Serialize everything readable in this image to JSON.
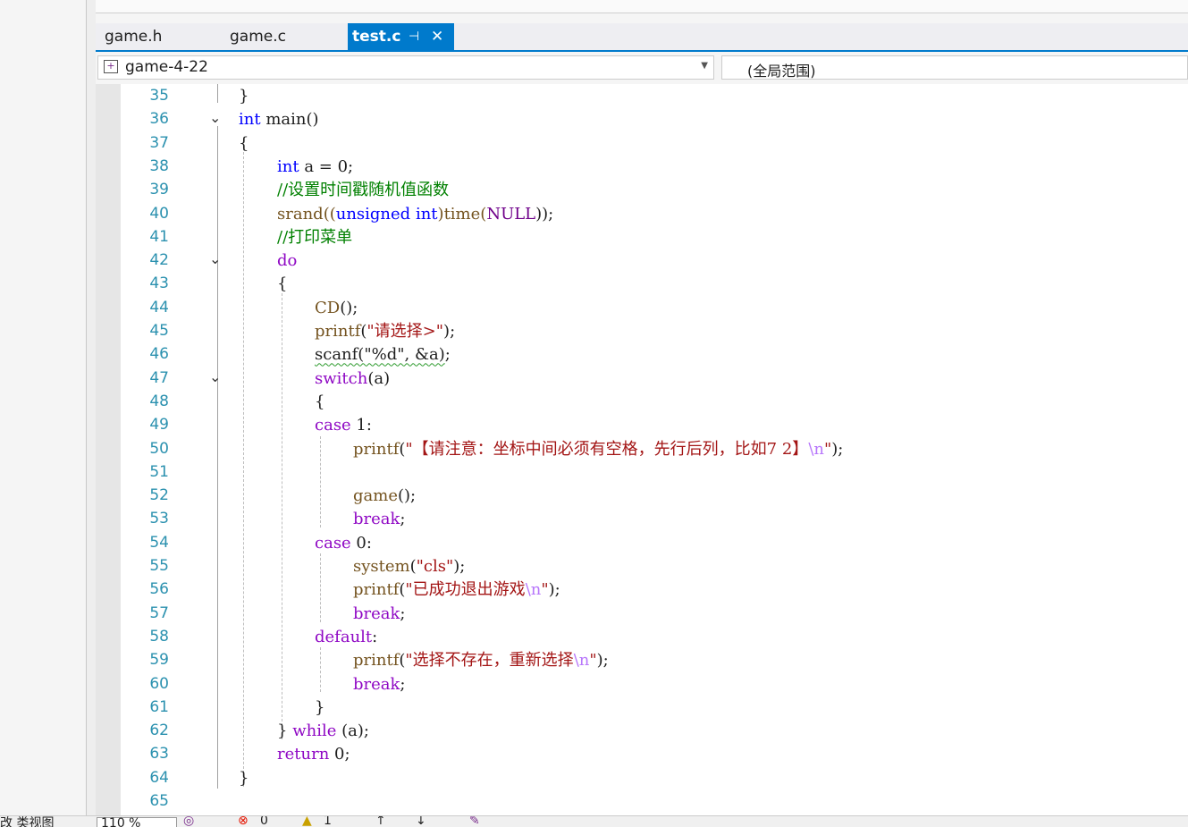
{
  "tabs": [
    {
      "label": "game.h",
      "active": false
    },
    {
      "label": "game.c",
      "active": false
    },
    {
      "label": "test.c",
      "active": true
    }
  ],
  "tab_pin_glyph": "⊣",
  "tab_close_glyph": "✕",
  "nav": {
    "project": "game-4-22",
    "scope": "(全局范围)"
  },
  "status": {
    "left_text": "改   类视图",
    "zoom": "110 %",
    "errors": "0",
    "warnings": "1"
  },
  "colors": {
    "accent": "#007acc",
    "line_number": "#2b91af",
    "keyword": "#0000ff",
    "control": "#8f08c4",
    "string": "#a31515",
    "comment": "#008000"
  },
  "code_lines": [
    {
      "n": "35",
      "fold": "",
      "indent": 0,
      "tokens": [
        [
          "}",
          ""
        ]
      ]
    },
    {
      "n": "36",
      "fold": "⌄",
      "indent": 0,
      "tokens": [
        [
          "int",
          "kw"
        ],
        [
          " main()",
          ""
        ]
      ]
    },
    {
      "n": "37",
      "fold": "",
      "indent": 0,
      "tokens": [
        [
          "{",
          ""
        ]
      ]
    },
    {
      "n": "38",
      "fold": "",
      "indent": 1,
      "tokens": [
        [
          "int",
          "kw"
        ],
        [
          " a = 0;",
          ""
        ]
      ]
    },
    {
      "n": "39",
      "fold": "",
      "indent": 1,
      "tokens": [
        [
          "//设置时间戳随机值函数",
          "cmt"
        ]
      ]
    },
    {
      "n": "40",
      "fold": "",
      "indent": 1,
      "tokens": [
        [
          "srand((",
          "fn"
        ],
        [
          "unsigned",
          "kw"
        ],
        [
          " ",
          ""
        ],
        [
          "int",
          "kw"
        ],
        [
          ")time(",
          "fn"
        ],
        [
          "NULL",
          "mac"
        ],
        [
          "));",
          ""
        ]
      ]
    },
    {
      "n": "41",
      "fold": "",
      "indent": 1,
      "tokens": [
        [
          "//打印菜单",
          "cmt"
        ]
      ]
    },
    {
      "n": "42",
      "fold": "⌄",
      "indent": 1,
      "tokens": [
        [
          "do",
          "ctl"
        ]
      ]
    },
    {
      "n": "43",
      "fold": "",
      "indent": 1,
      "tokens": [
        [
          "{",
          ""
        ]
      ]
    },
    {
      "n": "44",
      "fold": "",
      "indent": 2,
      "tokens": [
        [
          "CD",
          "fn"
        ],
        [
          "();",
          ""
        ]
      ]
    },
    {
      "n": "45",
      "fold": "",
      "indent": 2,
      "tokens": [
        [
          "printf",
          "fn"
        ],
        [
          "(",
          ""
        ],
        [
          "\"请选择>\"",
          "str"
        ],
        [
          ");",
          ""
        ]
      ]
    },
    {
      "n": "46",
      "fold": "",
      "indent": 2,
      "tokens": [
        [
          "scanf(\"%d\", &a)",
          "squig"
        ],
        [
          ";",
          ""
        ]
      ]
    },
    {
      "n": "47",
      "fold": "⌄",
      "indent": 2,
      "tokens": [
        [
          "switch",
          "ctl"
        ],
        [
          "(a)",
          ""
        ]
      ]
    },
    {
      "n": "48",
      "fold": "",
      "indent": 2,
      "tokens": [
        [
          "{",
          ""
        ]
      ]
    },
    {
      "n": "49",
      "fold": "",
      "indent": 2,
      "tokens": [
        [
          "case",
          "ctl"
        ],
        [
          " 1:",
          ""
        ]
      ]
    },
    {
      "n": "50",
      "fold": "",
      "indent": 3,
      "tokens": [
        [
          "printf",
          "fn"
        ],
        [
          "(",
          ""
        ],
        [
          "\"【请注意：坐标中间必须有空格，先行后列，比如7 2】",
          "str"
        ],
        [
          "\\n",
          "esc"
        ],
        [
          "\"",
          "str"
        ],
        [
          ");",
          ""
        ]
      ]
    },
    {
      "n": "51",
      "fold": "",
      "indent": 3,
      "tokens": []
    },
    {
      "n": "52",
      "fold": "",
      "indent": 3,
      "tokens": [
        [
          "game",
          "fn"
        ],
        [
          "();",
          ""
        ]
      ]
    },
    {
      "n": "53",
      "fold": "",
      "indent": 3,
      "tokens": [
        [
          "break",
          "ctl"
        ],
        [
          ";",
          ""
        ]
      ]
    },
    {
      "n": "54",
      "fold": "",
      "indent": 2,
      "tokens": [
        [
          "case",
          "ctl"
        ],
        [
          " 0:",
          ""
        ]
      ]
    },
    {
      "n": "55",
      "fold": "",
      "indent": 3,
      "tokens": [
        [
          "system",
          "fn"
        ],
        [
          "(",
          ""
        ],
        [
          "\"cls\"",
          "str"
        ],
        [
          ");",
          ""
        ]
      ]
    },
    {
      "n": "56",
      "fold": "",
      "indent": 3,
      "tokens": [
        [
          "printf",
          "fn"
        ],
        [
          "(",
          ""
        ],
        [
          "\"已成功退出游戏",
          "str"
        ],
        [
          "\\n",
          "esc"
        ],
        [
          "\"",
          "str"
        ],
        [
          ");",
          ""
        ]
      ]
    },
    {
      "n": "57",
      "fold": "",
      "indent": 3,
      "tokens": [
        [
          "break",
          "ctl"
        ],
        [
          ";",
          ""
        ]
      ]
    },
    {
      "n": "58",
      "fold": "",
      "indent": 2,
      "tokens": [
        [
          "default",
          "ctl"
        ],
        [
          ":",
          ""
        ]
      ]
    },
    {
      "n": "59",
      "fold": "",
      "indent": 3,
      "tokens": [
        [
          "printf",
          "fn"
        ],
        [
          "(",
          ""
        ],
        [
          "\"选择不存在，重新选择",
          "str"
        ],
        [
          "\\n",
          "esc"
        ],
        [
          "\"",
          "str"
        ],
        [
          ");",
          ""
        ]
      ]
    },
    {
      "n": "60",
      "fold": "",
      "indent": 3,
      "tokens": [
        [
          "break",
          "ctl"
        ],
        [
          ";",
          ""
        ]
      ]
    },
    {
      "n": "61",
      "fold": "",
      "indent": 2,
      "tokens": [
        [
          "}",
          ""
        ]
      ]
    },
    {
      "n": "62",
      "fold": "",
      "indent": 1,
      "tokens": [
        [
          "} ",
          ""
        ],
        [
          "while",
          "ctl"
        ],
        [
          " (a);",
          ""
        ]
      ]
    },
    {
      "n": "63",
      "fold": "",
      "indent": 1,
      "tokens": [
        [
          "return",
          "ctl"
        ],
        [
          " 0;",
          ""
        ]
      ]
    },
    {
      "n": "64",
      "fold": "",
      "indent": 0,
      "tokens": [
        [
          "}",
          ""
        ]
      ]
    },
    {
      "n": "65",
      "fold": "",
      "indent": 0,
      "tokens": []
    }
  ]
}
